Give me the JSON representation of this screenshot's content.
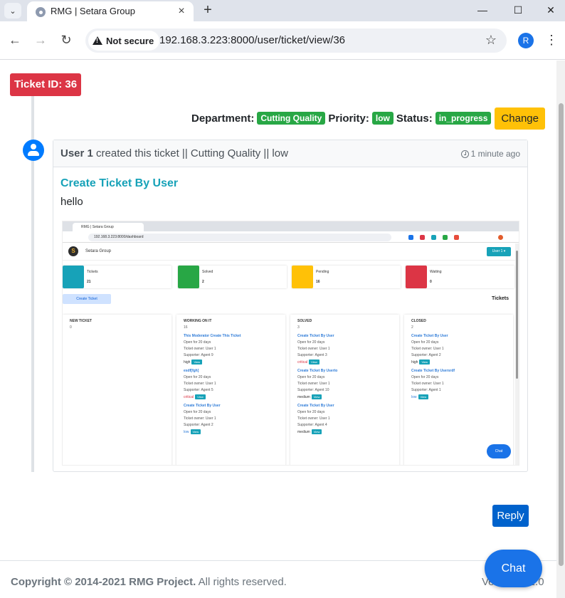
{
  "browser": {
    "tab_title": "RMG | Setara Group",
    "new_tab": "+",
    "not_secure": "Not secure",
    "url": "192.168.3.223:8000/user/ticket/view/36",
    "profile_initial": "R",
    "minimize": "—",
    "maximize": "☐",
    "close": "✕"
  },
  "ticket": {
    "id_label": "Ticket ID: 36",
    "department_label": "Department:",
    "department": "Cutting Quality",
    "priority_label": "Priority:",
    "priority": "low",
    "status_label": "Status:",
    "status": "in_progress",
    "change_label": "Change",
    "badge_color": "#28a745"
  },
  "message": {
    "user": "User 1",
    "action": " created this ticket || Cutting Quality || low",
    "time": "1 minute ago",
    "title": "Create Ticket By User",
    "body": "hello"
  },
  "attachment": {
    "tab_title": "RMG | Setara Group",
    "url": "192.168.3.223:8000/dashboard",
    "brand": "Setara Group",
    "logo_letter": "S",
    "user_menu": "User 1 ▾",
    "stats": [
      {
        "label": "Tickets",
        "value": "21",
        "color": "#17a2b8",
        "icon": "bookmark-icon"
      },
      {
        "label": "Solved",
        "value": "2",
        "color": "#28a745",
        "icon": "flag-icon"
      },
      {
        "label": "Pending",
        "value": "16",
        "color": "#ffc107",
        "icon": "copy-icon"
      },
      {
        "label": "Waiting",
        "value": "0",
        "color": "#dc3545",
        "icon": "star-icon"
      }
    ],
    "create_button": "Create Ticket",
    "tickets_title": "Tickets",
    "chat": "Chat",
    "columns": [
      {
        "title": "NEW TICKET",
        "count": "0",
        "items": []
      },
      {
        "title": "WORKING ON IT",
        "count": "16",
        "items": [
          {
            "title": "This Moderator Create This Ticket",
            "open": "Open for 20 days",
            "owner": "Ticket owner: User 1",
            "supporter": "Supporter: Agent 9",
            "priority": "high",
            "priority_color": "#333333"
          },
          {
            "title": "esdf[fgh]",
            "open": "Open for 20 days",
            "owner": "Ticket owner: User 1",
            "supporter": "Supporter: Agent 5",
            "priority": "critical",
            "priority_color": "#dc3545"
          },
          {
            "title": "Create Ticket By User",
            "open": "Open for 20 days",
            "owner": "Ticket owner: User 1",
            "supporter": "Supporter: Agent 2",
            "priority": "low",
            "priority_color": "#2f7cd8"
          }
        ]
      },
      {
        "title": "SOLVED",
        "count": "3",
        "items": [
          {
            "title": "Create Ticket By User",
            "open": "Open for 20 days",
            "owner": "Ticket owner: User 1",
            "supporter": "Supporter: Agent 3",
            "priority": "critical",
            "priority_color": "#dc3545"
          },
          {
            "title": "Create Ticket By Userto",
            "open": "Open for 20 days",
            "owner": "Ticket owner: User 1",
            "supporter": "Supporter: Agent 10",
            "priority": "medium",
            "priority_color": "#333333"
          },
          {
            "title": "Create Ticket By User",
            "open": "Open for 20 days",
            "owner": "Ticket owner: User 1",
            "supporter": "Supporter: Agent 4",
            "priority": "medium",
            "priority_color": "#333333"
          }
        ]
      },
      {
        "title": "CLOSED",
        "count": "2",
        "items": [
          {
            "title": "Create Ticket By User",
            "open": "Open for 20 days",
            "owner": "Ticket owner: User 1",
            "supporter": "Supporter: Agent 2",
            "priority": "high",
            "priority_color": "#333333"
          },
          {
            "title": "Create Ticket By Usersrdf",
            "open": "Open for 20 days",
            "owner": "Ticket owner: User 1",
            "supporter": "Supporter: Agent 1",
            "priority": "low",
            "priority_color": "#2f7cd8"
          }
        ]
      }
    ],
    "view_label": "View"
  },
  "reply_label": "Reply",
  "footer": {
    "copyright": "Copyright © 2014-2021 RMG Project.",
    "rights": " All rights reserved.",
    "version": "Version 3.2.0"
  },
  "chat_label": "Chat"
}
